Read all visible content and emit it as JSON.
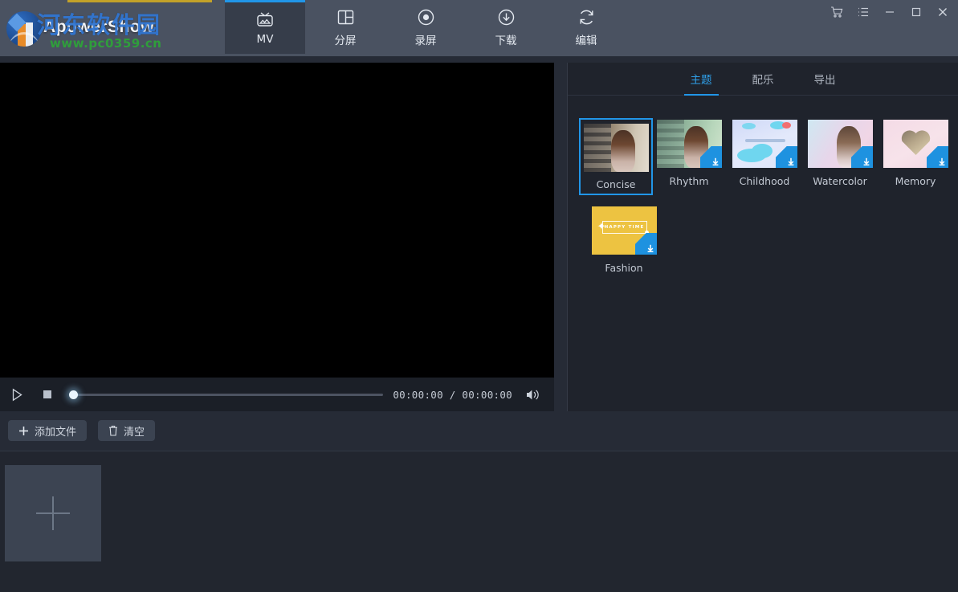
{
  "app": {
    "brand": "ApowerShow",
    "watermark_cn": "河东软件园",
    "watermark_url": "www.pc0359.cn"
  },
  "header": {
    "tabs": [
      {
        "label": "MV",
        "icon": "tv-mv-icon",
        "active": true
      },
      {
        "label": "分屏",
        "icon": "split-screen-icon",
        "active": false
      },
      {
        "label": "录屏",
        "icon": "record-screen-icon",
        "active": false
      },
      {
        "label": "下载",
        "icon": "download-icon",
        "active": false
      },
      {
        "label": "编辑",
        "icon": "edit-refresh-icon",
        "active": false
      }
    ],
    "window_controls": [
      {
        "name": "cart-icon",
        "title": "购物车"
      },
      {
        "name": "menu-list-icon",
        "title": "菜单"
      },
      {
        "name": "minimize-icon",
        "title": "最小化"
      },
      {
        "name": "maximize-icon",
        "title": "最大化"
      },
      {
        "name": "close-icon",
        "title": "关闭"
      }
    ]
  },
  "player": {
    "play_label": "播放",
    "stop_label": "停止",
    "time_display": "00:00:00 / 00:00:00",
    "current_time": "00:00:00",
    "total_time": "00:00:00",
    "progress_percent": 0,
    "volume_label": "音量"
  },
  "actions": {
    "add_file_label": "添加文件",
    "clear_label": "清空"
  },
  "right_panel": {
    "tabs": [
      {
        "label": "主题",
        "active": true
      },
      {
        "label": "配乐",
        "active": false
      },
      {
        "label": "导出",
        "active": false
      }
    ],
    "themes": [
      {
        "label": "Concise",
        "selected": true,
        "downloadable": false,
        "art": "t-concise"
      },
      {
        "label": "Rhythm",
        "selected": false,
        "downloadable": true,
        "art": "t-rhythm"
      },
      {
        "label": "Childhood",
        "selected": false,
        "downloadable": true,
        "art": "t-child"
      },
      {
        "label": "Watercolor",
        "selected": false,
        "downloadable": true,
        "art": "t-water"
      },
      {
        "label": "Memory",
        "selected": false,
        "downloadable": true,
        "art": "t-memory"
      },
      {
        "label": "Fashion",
        "selected": false,
        "downloadable": true,
        "art": "t-fashion"
      }
    ],
    "fashion_thumb_text": "HAPPY TIME"
  },
  "timeline": {
    "add_media_label": "添加素材"
  },
  "colors": {
    "accent": "#2196e8",
    "header_bg": "#4a5261",
    "body_bg": "#262b36",
    "panel_bg": "#1f232c",
    "preview_bg": "#000000",
    "badge_blue": "#1e92e0",
    "watermark_green": "#2f9e3b"
  }
}
